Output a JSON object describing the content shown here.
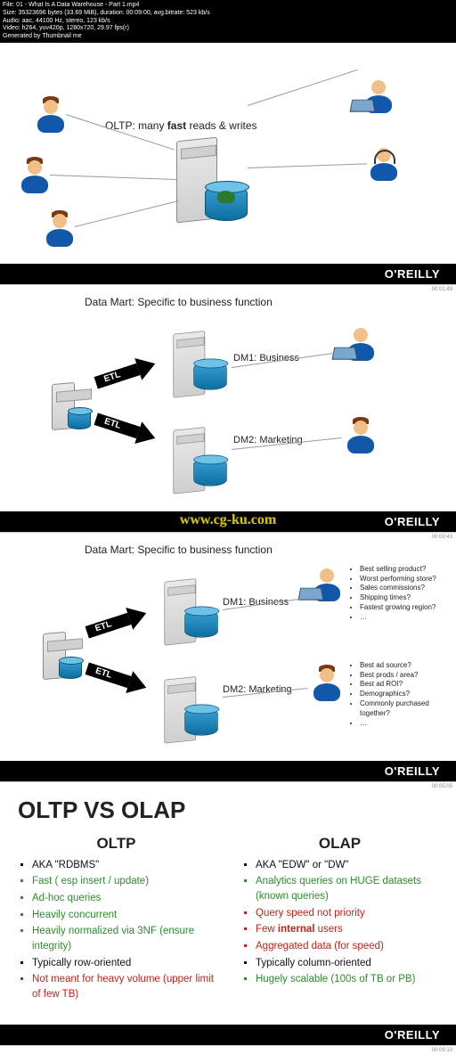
{
  "meta": {
    "l1": "File: 01 - What Is A Data Warehouse - Part 1.mp4",
    "l2": "Size: 35323696 bytes (33.69 MiB), duration: 00:09:00, avg.bitrate: 523 kb/s",
    "l3": "Audio: aac, 44100 Hz, stereo, 123 kb/s",
    "l4": "Video: h264, yuv420p, 1280x720, 29.97 fps(r)",
    "l5": "Generated by Thumbnail me"
  },
  "brand": "O'REILLY",
  "watermark": "www.cg-ku.com",
  "panel1": {
    "caption_a": "OLTP: many ",
    "caption_b": "fast",
    "caption_c": " reads & writes",
    "ts": "00:01:49"
  },
  "panel2": {
    "title": "Data Mart: Specific to business function",
    "etl": "ETL",
    "dm1": "DM1: Business",
    "dm2": "DM2: Marketing",
    "ts": "00:03:43"
  },
  "panel3": {
    "title": "Data Mart: Specific to business function",
    "etl": "ETL",
    "dm1": "DM1: Business",
    "dm2": "DM2: Marketing",
    "q_business": [
      "Best selling product?",
      "Worst performing store?",
      "Sales commissions?",
      "Shipping times?",
      "Fastest growing region?",
      "…"
    ],
    "q_marketing": [
      "Best ad source?",
      "Best prods / area?",
      "Best ad ROI?",
      "Demographics?",
      "Commonly purchased together?",
      "…"
    ],
    "ts": "00:05:05"
  },
  "panel4": {
    "heading": "OLTP VS OLAP",
    "left_h": "OLTP",
    "right_h": "OLAP",
    "left": [
      {
        "t": "AKA \"RDBMS\"",
        "c": "k"
      },
      {
        "t": "Fast ( esp insert / update)",
        "c": "g"
      },
      {
        "t": "Ad-hoc queries",
        "c": "g"
      },
      {
        "t": "Heavily concurrent",
        "c": "g"
      },
      {
        "t": "Heavily normalized via 3NF (ensure integrity)",
        "c": "g"
      },
      {
        "t": "Typically row-oriented",
        "c": "k"
      },
      {
        "t": "Not meant for heavy volume (upper limit of few TB)",
        "c": "r"
      }
    ],
    "right": [
      {
        "t": "AKA \"EDW\" or \"DW\"",
        "c": "k"
      },
      {
        "t": "Analytics queries on HUGE datasets (known queries)",
        "c": "g"
      },
      {
        "t": "Query speed not priority",
        "c": "r"
      },
      {
        "t_pre": "Few ",
        "t_b": "internal",
        "t_post": " users",
        "c": "r"
      },
      {
        "t": "Aggregated data (for speed)",
        "c": "r"
      },
      {
        "t": "Typically column-oriented",
        "c": "k"
      },
      {
        "t": "Hugely scalable (100s of TB or PB)",
        "c": "g"
      }
    ],
    "ts": "00:09:13"
  }
}
